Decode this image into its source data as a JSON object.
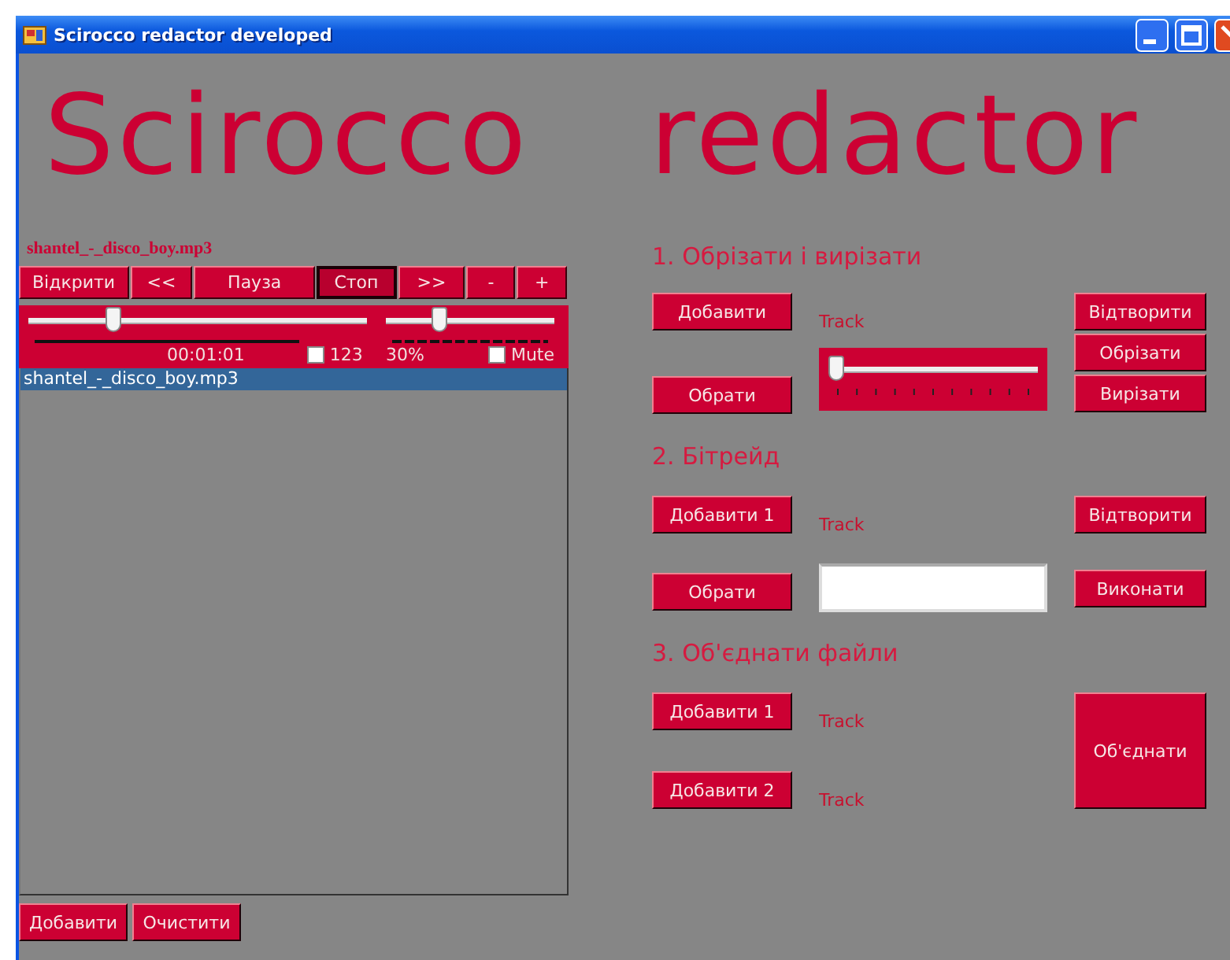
{
  "window": {
    "title": "Scirocco redactor developed"
  },
  "banner": "Scirocco redactor",
  "player": {
    "file_label": "shantel_-_disco_boy.mp3",
    "controls": [
      {
        "label": "Відкрити",
        "pressed": false
      },
      {
        "label": "<<",
        "pressed": false
      },
      {
        "label": "Пауза",
        "pressed": false
      },
      {
        "label": "Стоп",
        "pressed": true
      },
      {
        "label": ">>",
        "pressed": false
      },
      {
        "label": "-",
        "pressed": false
      },
      {
        "label": "+",
        "pressed": false
      }
    ],
    "position": {
      "level": 0.24
    },
    "time": "00:01:01",
    "loop": {
      "label": "123",
      "checked": false
    },
    "volume": {
      "level": 0.3
    },
    "volume_reading": "30%",
    "mute": {
      "label": "Mute",
      "checked": false
    }
  },
  "playlist": {
    "items": [
      {
        "name": "shantel_-_disco_boy.mp3",
        "selected": true
      }
    ]
  },
  "playlist_buttons": [
    "Добавити",
    "Очистити"
  ],
  "trim": {
    "heading": "1. Обрізати і вирізати",
    "add_button": "Добавити",
    "select_button": "Обрати",
    "track_label": "Track",
    "slider": {
      "level": 0
    },
    "buttons": [
      "Відтворити",
      "Обрізати",
      "Вирізати"
    ]
  },
  "bitrate": {
    "heading": "2. Бітрейд",
    "add_button": "Добавити 1",
    "select_button": "Обрати",
    "track_label": "Track",
    "buttons": [
      "Відтворити",
      "Виконати"
    ]
  },
  "merge": {
    "heading": "3. Об'єднати файли",
    "add_buttons": [
      "Добавити 1",
      "Добавити 2"
    ],
    "track_labels": [
      "Track",
      "Track"
    ],
    "merge_button": "Об'єднати"
  }
}
